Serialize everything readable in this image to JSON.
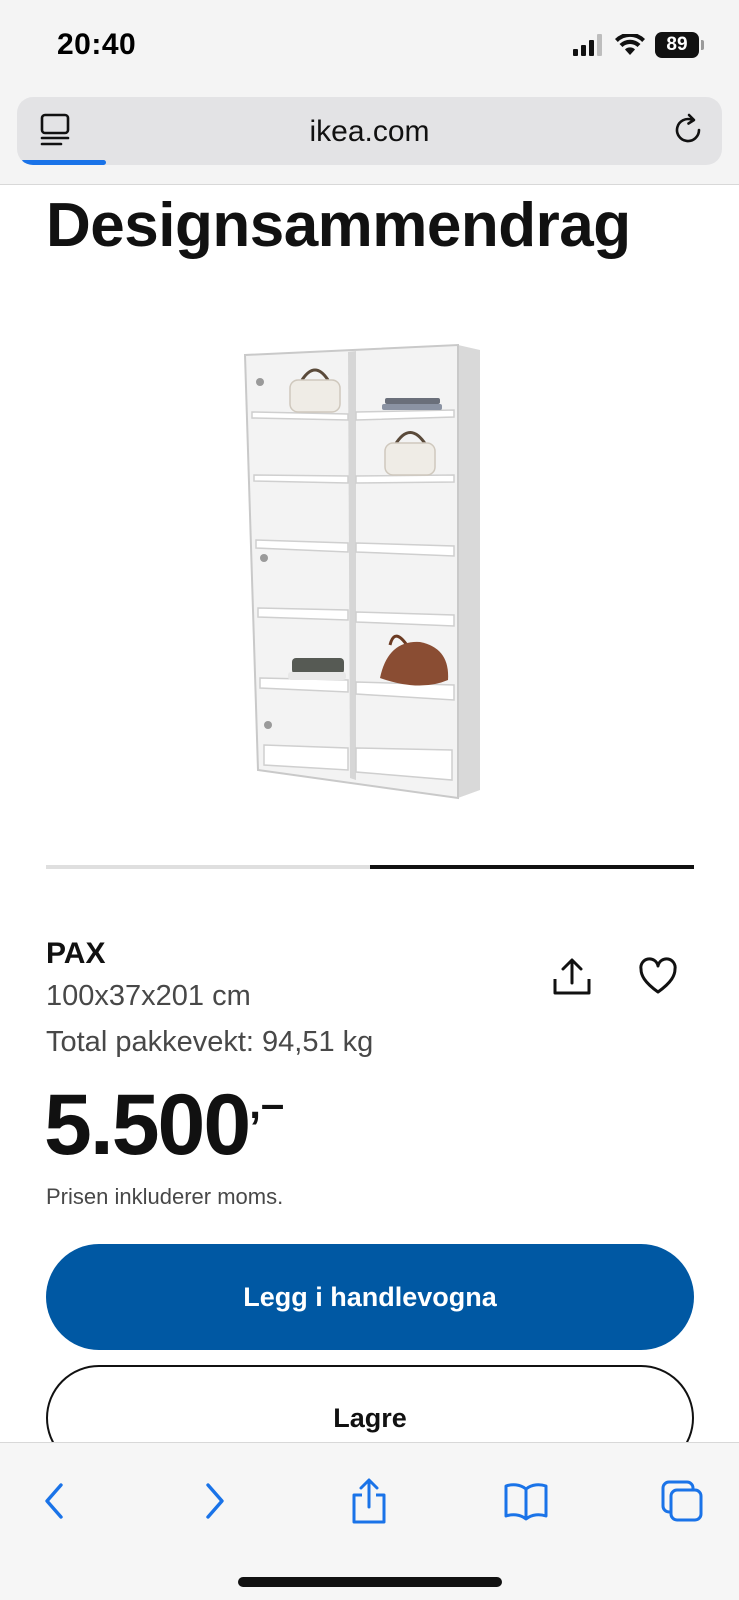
{
  "status_bar": {
    "time": "20:40",
    "battery": "89",
    "icons": [
      "signal-icon",
      "wifi-icon",
      "battery-icon"
    ]
  },
  "browser": {
    "url": "ikea.com",
    "load_progress": 0.12,
    "icons": [
      "reader-icon",
      "reload-icon"
    ]
  },
  "page": {
    "title": "Designsammendrag",
    "carousel": {
      "slides": 2,
      "active": 2
    }
  },
  "product": {
    "name": "PAX",
    "dimensions": "100x37x201 cm",
    "weight": "Total pakkevekt: 94,51 kg",
    "price": "5.500",
    "price_suffix": ",–",
    "price_note": "Prisen inkluderer moms."
  },
  "actions": {
    "add_to_cart": "Legg i handlevogna",
    "save": "Lagre"
  },
  "toolbar": {
    "icons": [
      "back-icon",
      "forward-icon",
      "share-icon",
      "bookmarks-icon",
      "tabs-icon"
    ]
  },
  "colors": {
    "primary": "#0058a3",
    "link": "#1a73e8",
    "text": "#111111",
    "muted": "#484848"
  }
}
